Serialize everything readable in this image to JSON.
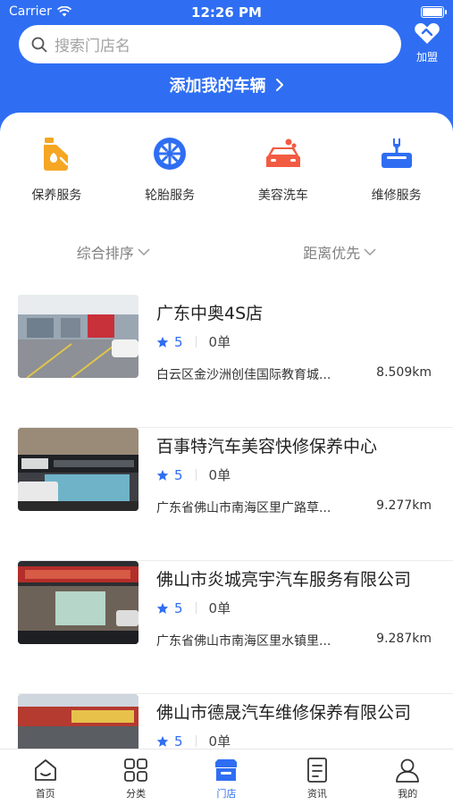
{
  "status_bar": {
    "carrier": "Carrier",
    "time": "12:26 PM"
  },
  "search": {
    "placeholder": "搜索门店名"
  },
  "join": {
    "label": "加盟"
  },
  "add_car": {
    "label": "添加我的车辆"
  },
  "services": [
    {
      "label": "保养服务",
      "icon": "oil-bottle-icon"
    },
    {
      "label": "轮胎服务",
      "icon": "tire-icon"
    },
    {
      "label": "美容洗车",
      "icon": "car-wash-icon"
    },
    {
      "label": "维修服务",
      "icon": "repair-icon"
    }
  ],
  "sorts": [
    {
      "label": "综合排序"
    },
    {
      "label": "距离优先"
    }
  ],
  "stores": [
    {
      "name": "广东中奥4S店",
      "rating": "5",
      "orders": "0单",
      "address": "白云区金沙洲创佳国际教育城...",
      "distance": "8.509km"
    },
    {
      "name": "百事特汽车美容快修保养中心",
      "rating": "5",
      "orders": "0单",
      "address": "广东省佛山市南海区里广路草...",
      "distance": "9.277km"
    },
    {
      "name": "佛山市炎城亮宇汽车服务有限公司",
      "rating": "5",
      "orders": "0单",
      "address": "广东省佛山市南海区里水镇里...",
      "distance": "9.287km"
    },
    {
      "name": "佛山市德晟汽车维修保养有限公司",
      "rating": "5",
      "orders": "0单",
      "address": "",
      "distance": ""
    }
  ],
  "tabs": [
    {
      "label": "首页",
      "icon": "home-icon"
    },
    {
      "label": "分类",
      "icon": "category-icon"
    },
    {
      "label": "门店",
      "icon": "store-icon"
    },
    {
      "label": "资讯",
      "icon": "news-icon"
    },
    {
      "label": "我的",
      "icon": "profile-icon"
    }
  ],
  "colors": {
    "primary": "#2f6ef3",
    "oil": "#f5a623",
    "wash": "#f25b42"
  }
}
